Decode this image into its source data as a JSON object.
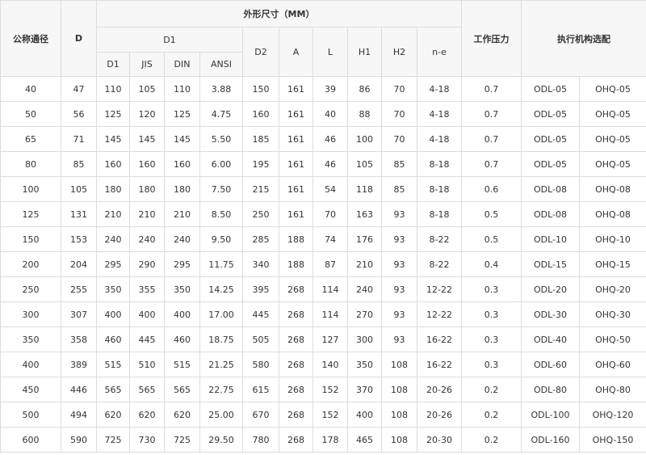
{
  "headers": {
    "nominal_diameter": "公称通径",
    "d": "D",
    "dimensions_group": "外形尺寸（MM）",
    "d1_group": "D1",
    "d1": "D1",
    "jis": "JIS",
    "din": "DIN",
    "ansi": "ANSI",
    "d2": "D2",
    "a": "A",
    "l": "L",
    "h1": "H1",
    "h2": "H2",
    "ne": "n-e",
    "pressure": "工作压力",
    "actuator": "执行机构选配"
  },
  "rows": [
    [
      "40",
      "47",
      "110",
      "105",
      "110",
      "3.88",
      "150",
      "161",
      "39",
      "86",
      "70",
      "4-18",
      "0.7",
      "ODL-05",
      "OHQ-05"
    ],
    [
      "50",
      "56",
      "125",
      "120",
      "125",
      "4.75",
      "160",
      "161",
      "40",
      "88",
      "70",
      "4-18",
      "0.7",
      "ODL-05",
      "OHQ-05"
    ],
    [
      "65",
      "71",
      "145",
      "145",
      "145",
      "5.50",
      "185",
      "161",
      "46",
      "100",
      "70",
      "4-18",
      "0.7",
      "ODL-05",
      "OHQ-05"
    ],
    [
      "80",
      "85",
      "160",
      "160",
      "160",
      "6.00",
      "195",
      "161",
      "46",
      "105",
      "85",
      "8-18",
      "0.7",
      "ODL-05",
      "OHQ-05"
    ],
    [
      "100",
      "105",
      "180",
      "180",
      "180",
      "7.50",
      "215",
      "161",
      "54",
      "118",
      "85",
      "8-18",
      "0.6",
      "ODL-08",
      "OHQ-08"
    ],
    [
      "125",
      "131",
      "210",
      "210",
      "210",
      "8.50",
      "250",
      "161",
      "70",
      "163",
      "93",
      "8-18",
      "0.5",
      "ODL-08",
      "OHQ-08"
    ],
    [
      "150",
      "153",
      "240",
      "240",
      "240",
      "9.50",
      "285",
      "188",
      "74",
      "176",
      "93",
      "8-22",
      "0.5",
      "ODL-10",
      "OHQ-10"
    ],
    [
      "200",
      "204",
      "295",
      "290",
      "295",
      "11.75",
      "340",
      "188",
      "87",
      "210",
      "93",
      "8-22",
      "0.4",
      "ODL-15",
      "OHQ-15"
    ],
    [
      "250",
      "255",
      "350",
      "355",
      "350",
      "14.25",
      "395",
      "268",
      "114",
      "240",
      "93",
      "12-22",
      "0.3",
      "ODL-20",
      "OHQ-20"
    ],
    [
      "300",
      "307",
      "400",
      "400",
      "400",
      "17.00",
      "445",
      "268",
      "114",
      "270",
      "93",
      "12-22",
      "0.3",
      "ODL-30",
      "OHQ-30"
    ],
    [
      "350",
      "358",
      "460",
      "445",
      "460",
      "18.75",
      "505",
      "268",
      "127",
      "300",
      "93",
      "16-22",
      "0.3",
      "ODL-40",
      "OHQ-50"
    ],
    [
      "400",
      "389",
      "515",
      "510",
      "515",
      "21.25",
      "580",
      "268",
      "140",
      "350",
      "108",
      "16-22",
      "0.3",
      "ODL-60",
      "OHQ-60"
    ],
    [
      "450",
      "446",
      "565",
      "565",
      "565",
      "22.75",
      "615",
      "268",
      "152",
      "370",
      "108",
      "20-26",
      "0.2",
      "ODL-80",
      "OHQ-80"
    ],
    [
      "500",
      "494",
      "620",
      "620",
      "620",
      "25.00",
      "670",
      "268",
      "152",
      "400",
      "108",
      "20-26",
      "0.2",
      "ODL-100",
      "OHQ-120"
    ],
    [
      "600",
      "590",
      "725",
      "730",
      "725",
      "29.50",
      "780",
      "268",
      "178",
      "465",
      "108",
      "20-30",
      "0.2",
      "ODL-160",
      "OHQ-150"
    ]
  ]
}
